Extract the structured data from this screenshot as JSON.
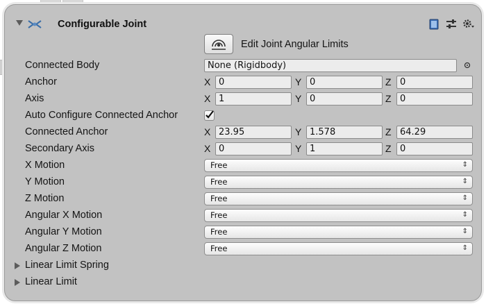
{
  "component": {
    "title": "Configurable Joint",
    "icons": [
      "fold-arrow-icon",
      "joint-icon",
      "book-icon",
      "sliders-icon",
      "gear-icon"
    ]
  },
  "edit_button": {
    "label": "Edit Joint Angular Limits",
    "icon": "joint-edit-icon"
  },
  "connected_body": {
    "label": "Connected Body",
    "value": "None (Rigidbody)"
  },
  "axes": {
    "x": "X",
    "y": "Y",
    "z": "Z"
  },
  "vectors": [
    {
      "key": "anchor",
      "label": "Anchor",
      "x": "0",
      "y": "0",
      "z": "0"
    },
    {
      "key": "axis",
      "label": "Axis",
      "x": "1",
      "y": "0",
      "z": "0"
    }
  ],
  "auto_configure": {
    "label": "Auto Configure Connected Anchor",
    "checked": true
  },
  "vectors2": [
    {
      "key": "connected-anchor",
      "label": "Connected Anchor",
      "x": "23.95",
      "y": "1.578",
      "z": "64.29"
    },
    {
      "key": "secondary-axis",
      "label": "Secondary Axis",
      "x": "0",
      "y": "1",
      "z": "0"
    }
  ],
  "motions": [
    {
      "key": "x-motion",
      "label": "X Motion",
      "value": "Free"
    },
    {
      "key": "y-motion",
      "label": "Y Motion",
      "value": "Free"
    },
    {
      "key": "z-motion",
      "label": "Z Motion",
      "value": "Free"
    },
    {
      "key": "angular-x-motion",
      "label": "Angular X Motion",
      "value": "Free"
    },
    {
      "key": "angular-y-motion",
      "label": "Angular Y Motion",
      "value": "Free"
    },
    {
      "key": "angular-z-motion",
      "label": "Angular Z Motion",
      "value": "Free"
    }
  ],
  "foldouts": [
    {
      "key": "linear-limit-spring",
      "label": "Linear Limit Spring"
    },
    {
      "key": "linear-limit",
      "label": "Linear Limit"
    }
  ],
  "colors": {
    "panel": "#c2c2c2",
    "field": "#ececec",
    "border": "#8a8a8a"
  }
}
